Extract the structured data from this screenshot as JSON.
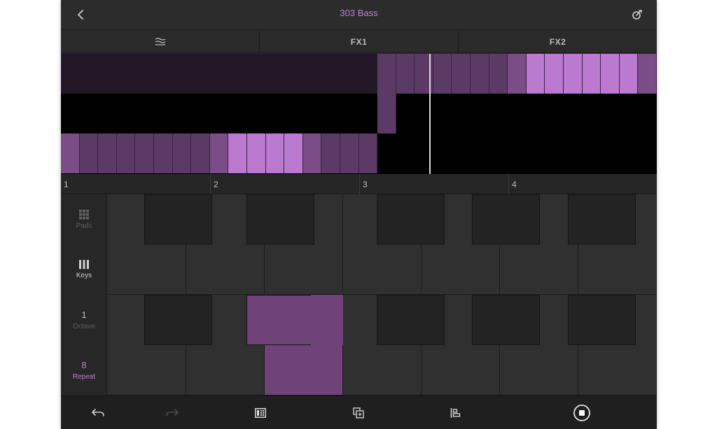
{
  "header": {
    "title": "303 Bass",
    "back_icon": "chevron-left-icon",
    "tuner_icon": "tuner-icon"
  },
  "tabs": [
    {
      "label": "",
      "icon": "waveform-icon"
    },
    {
      "label": "FX1"
    },
    {
      "label": "FX2"
    }
  ],
  "ruler": {
    "bars": [
      "1",
      "2",
      "3",
      "4"
    ]
  },
  "sidebar": {
    "pads_label": "Pads",
    "keys_label": "Keys",
    "octave_value": "1",
    "octave_label": "Octave",
    "repeat_value": "8",
    "repeat_label": "Repeat"
  },
  "colors": {
    "accent": "#c07ed6",
    "clip_dark": "#231827",
    "step_dark": "#5c3a66",
    "step_mid": "#7a4d86",
    "step_light": "#b97ad0",
    "active_key": "#6f4278"
  },
  "bottom_toolbar": {
    "icons": [
      "undo-icon",
      "redo-icon",
      "sequencer-view-icon",
      "duplicate-icon",
      "align-icon",
      "stop-icon"
    ]
  }
}
